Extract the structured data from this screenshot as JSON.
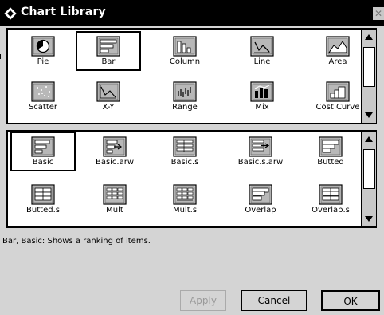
{
  "window": {
    "title": "Chart Library",
    "close_glyph": "✕"
  },
  "chart_types": {
    "selected": "Bar",
    "items": [
      {
        "label": "Pie",
        "icon": "pie-icon"
      },
      {
        "label": "Bar",
        "icon": "bar-icon"
      },
      {
        "label": "Column",
        "icon": "column-icon"
      },
      {
        "label": "Line",
        "icon": "line-icon"
      },
      {
        "label": "Area",
        "icon": "area-icon"
      },
      {
        "label": "Scatter",
        "icon": "scatter-icon"
      },
      {
        "label": "X-Y",
        "icon": "xy-icon"
      },
      {
        "label": "Range",
        "icon": "range-icon"
      },
      {
        "label": "Mix",
        "icon": "mix-icon"
      },
      {
        "label": "Cost Curve",
        "icon": "cost-curve-icon"
      }
    ]
  },
  "chart_styles": {
    "selected": "Basic",
    "items": [
      {
        "label": "Basic",
        "icon": "bar-basic-icon"
      },
      {
        "label": "Basic.arw",
        "icon": "bar-basic-arrow-icon"
      },
      {
        "label": "Basic.s",
        "icon": "bar-basic-s-icon"
      },
      {
        "label": "Basic.s.arw",
        "icon": "bar-basic-s-arrow-icon"
      },
      {
        "label": "Butted",
        "icon": "bar-butted-icon"
      },
      {
        "label": "Butted.s",
        "icon": "bar-butted-s-icon"
      },
      {
        "label": "Mult",
        "icon": "bar-mult-icon"
      },
      {
        "label": "Mult.s",
        "icon": "bar-mult-s-icon"
      },
      {
        "label": "Overlap",
        "icon": "bar-overlap-icon"
      },
      {
        "label": "Overlap.s",
        "icon": "bar-overlap-s-icon"
      }
    ]
  },
  "description": "Bar, Basic:  Shows a ranking of items.",
  "buttons": {
    "apply": "Apply",
    "cancel": "Cancel",
    "ok": "OK"
  }
}
